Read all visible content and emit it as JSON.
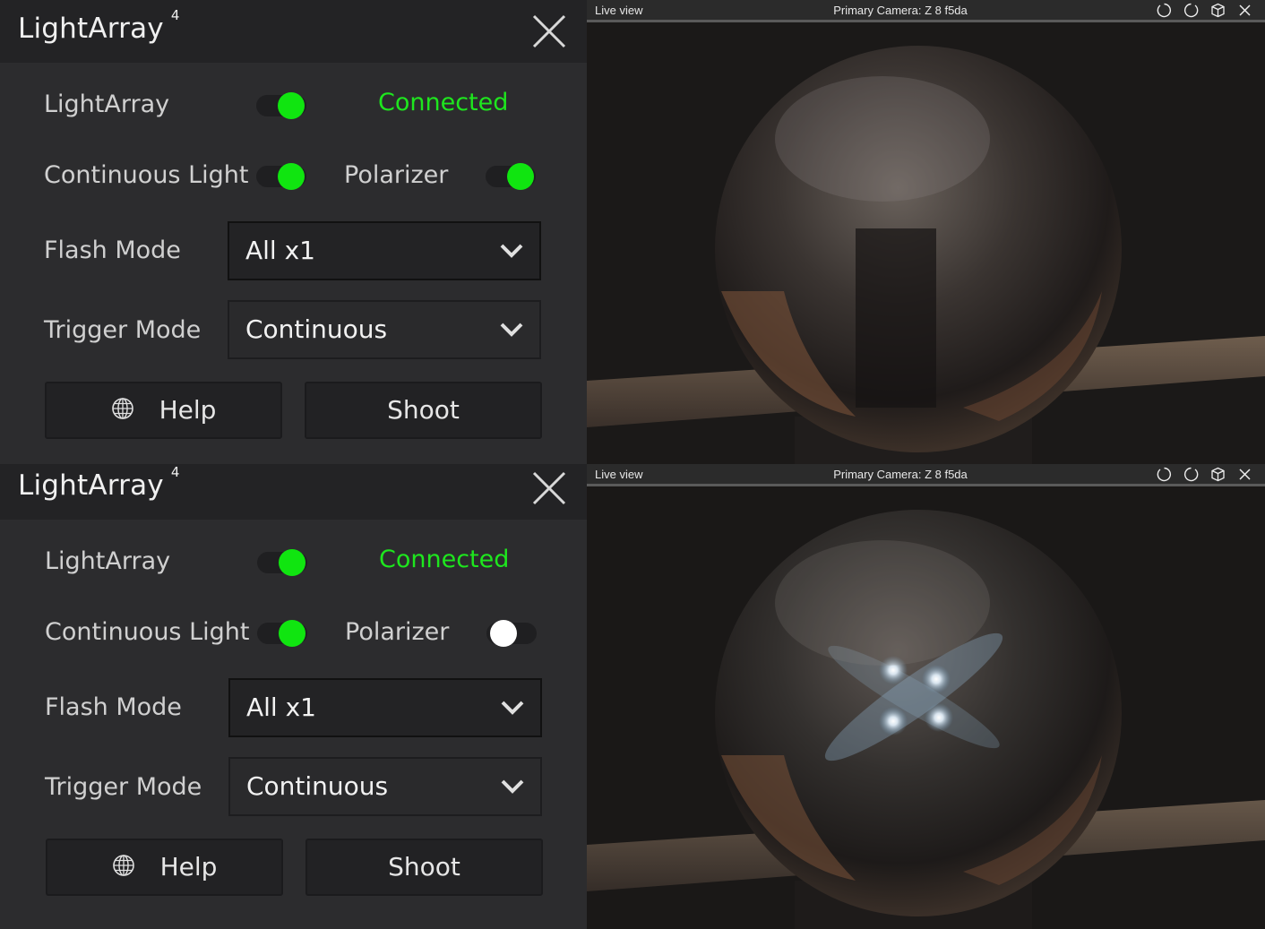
{
  "panels": [
    {
      "title": "LightArray",
      "badge": "4",
      "rows": {
        "lightarray_label": "LightArray",
        "status": "Connected",
        "continuous_label": "Continuous Light",
        "polarizer_label": "Polarizer",
        "flash_label": "Flash Mode",
        "flash_value": "All x1",
        "trigger_label": "Trigger Mode",
        "trigger_value": "Continuous"
      },
      "toggles": {
        "lightarray": "on",
        "continuous": "on",
        "polarizer": "on"
      },
      "buttons": {
        "help": "Help",
        "shoot": "Shoot"
      }
    },
    {
      "title": "LightArray",
      "badge": "4",
      "rows": {
        "lightarray_label": "LightArray",
        "status": "Connected",
        "continuous_label": "Continuous Light",
        "polarizer_label": "Polarizer",
        "flash_label": "Flash Mode",
        "flash_value": "All x1",
        "trigger_label": "Trigger Mode",
        "trigger_value": "Continuous"
      },
      "toggles": {
        "lightarray": "on",
        "continuous": "on",
        "polarizer": "off"
      },
      "buttons": {
        "help": "Help",
        "shoot": "Shoot"
      }
    }
  ],
  "views": [
    {
      "label": "Live view",
      "camera": "Primary Camera: Z 8 f5da",
      "icons": [
        "rotate-left-icon",
        "rotate-right-icon",
        "cube-icon",
        "close-icon"
      ]
    },
    {
      "label": "Live view",
      "camera": "Primary Camera: Z 8 f5da",
      "icons": [
        "rotate-left-icon",
        "rotate-right-icon",
        "cube-icon",
        "close-icon"
      ]
    }
  ],
  "colors": {
    "accent_green": "#10e510",
    "status_green": "#1ee61e",
    "panel_bg": "#2c2c2e",
    "header_bg": "#232325"
  }
}
